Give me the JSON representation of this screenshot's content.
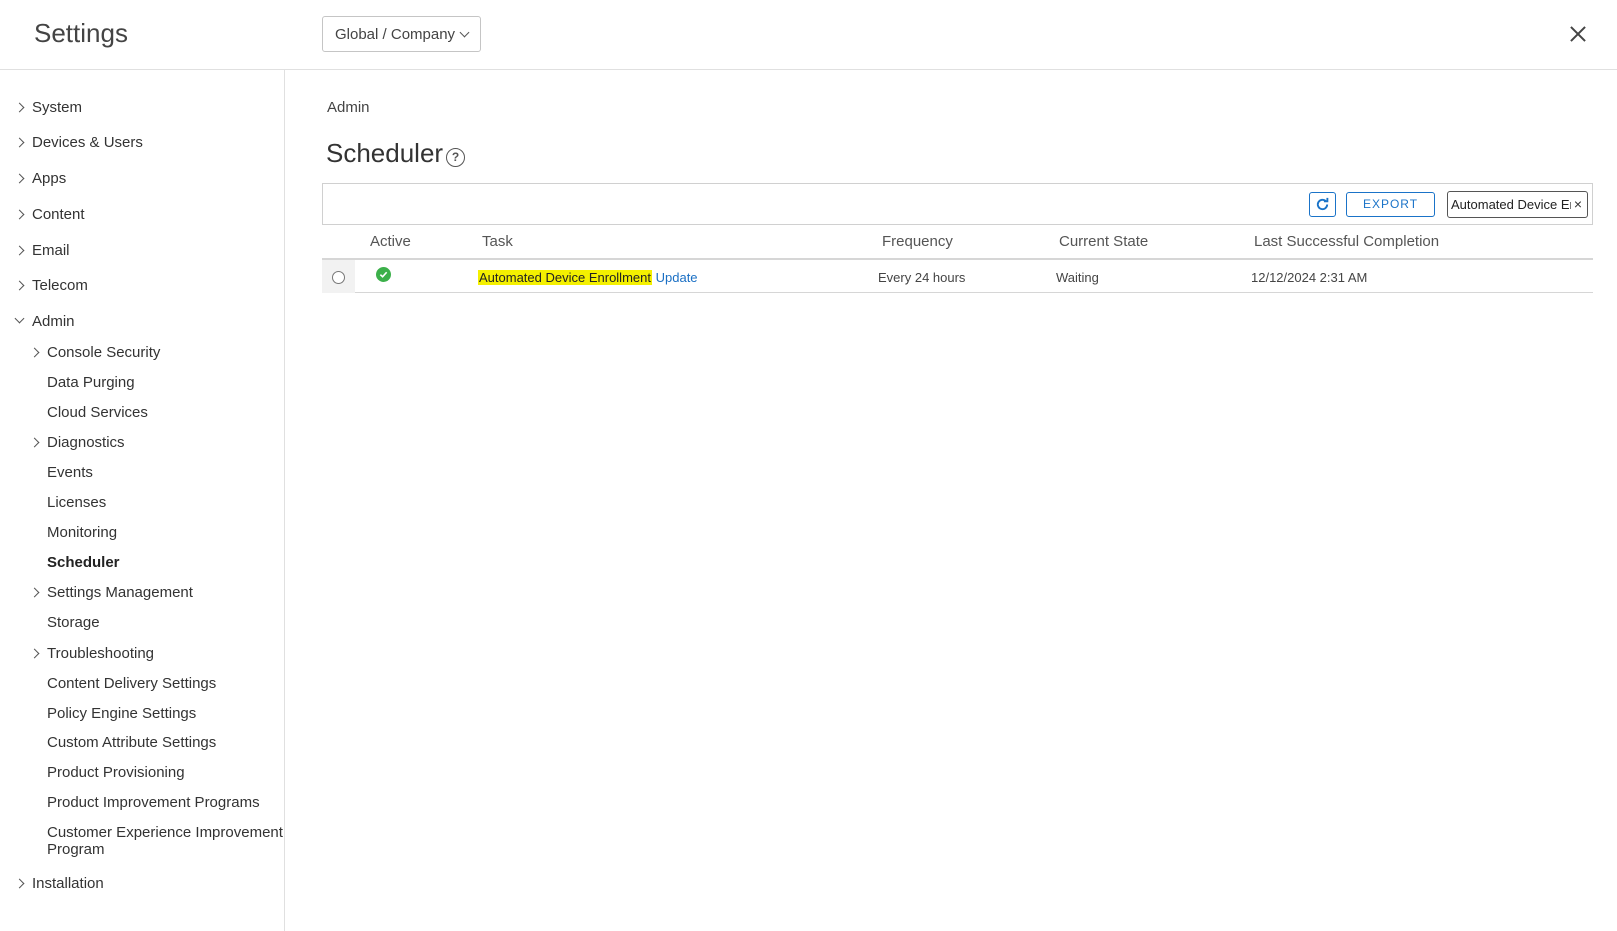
{
  "header": {
    "title": "Settings",
    "org_selector": "Global / Company",
    "close_icon": "close-icon"
  },
  "sidebar": {
    "items": [
      {
        "label": "System"
      },
      {
        "label": "Devices & Users"
      },
      {
        "label": "Apps"
      },
      {
        "label": "Content"
      },
      {
        "label": "Email"
      },
      {
        "label": "Telecom"
      },
      {
        "label": "Admin"
      },
      {
        "label": "Installation"
      }
    ],
    "admin_children": [
      {
        "label": "Console Security"
      },
      {
        "label": "Data Purging"
      },
      {
        "label": "Cloud Services"
      },
      {
        "label": "Diagnostics"
      },
      {
        "label": "Events"
      },
      {
        "label": "Licenses"
      },
      {
        "label": "Monitoring"
      },
      {
        "label": "Scheduler"
      },
      {
        "label": "Settings Management"
      },
      {
        "label": "Storage"
      },
      {
        "label": "Troubleshooting"
      },
      {
        "label": "Content Delivery Settings"
      },
      {
        "label": "Policy Engine Settings"
      },
      {
        "label": "Custom Attribute Settings"
      },
      {
        "label": "Product Provisioning"
      },
      {
        "label": "Product Improvement Programs"
      },
      {
        "label": "Customer Experience Improvement Program"
      }
    ],
    "active_item": "Scheduler"
  },
  "main": {
    "breadcrumb": "Admin",
    "title": "Scheduler",
    "help_glyph": "?",
    "toolbar": {
      "export_label": "EXPORT",
      "search_value": "Automated Device Enrollment",
      "clear_glyph": "×"
    },
    "table": {
      "columns": [
        "Active",
        "Task",
        "Frequency",
        "Current State",
        "Last Successful Completion"
      ],
      "rows": [
        {
          "active": true,
          "task_highlight": "Automated Device Enrollment",
          "task_link": "Update",
          "frequency": "Every 24 hours",
          "state": "Waiting",
          "last_completion": "12/12/2024 2:31 AM"
        }
      ]
    }
  },
  "colors": {
    "accent": "#1a73c8",
    "success": "#3cb04a",
    "highlight": "#f4f000"
  }
}
